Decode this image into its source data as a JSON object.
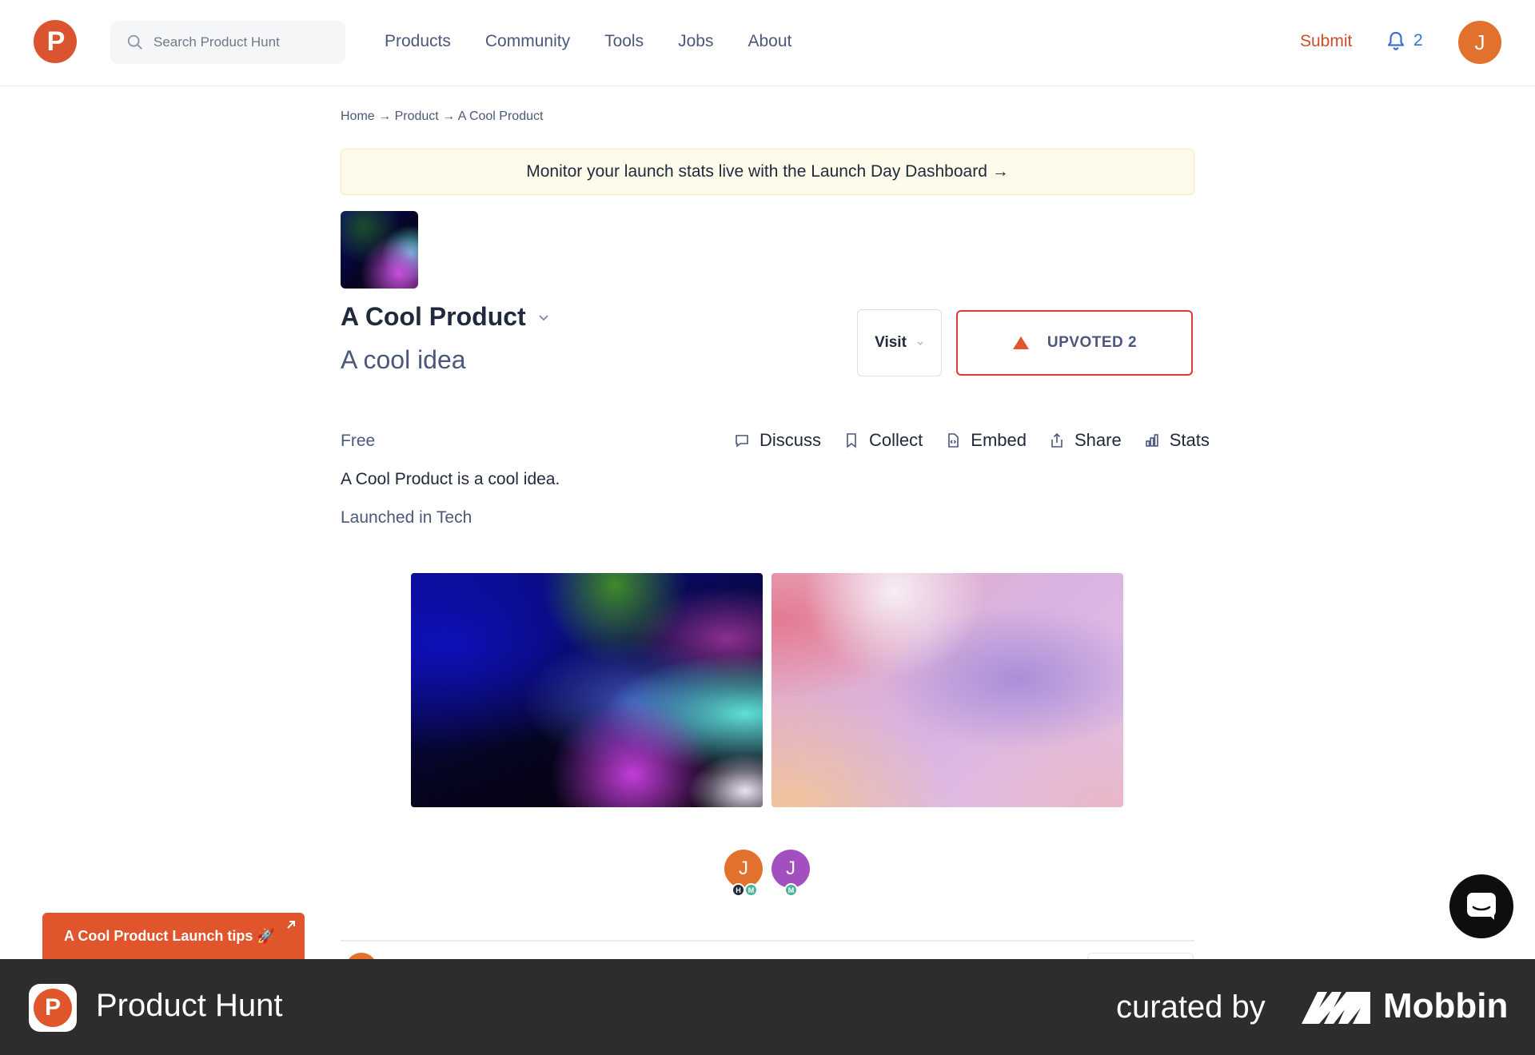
{
  "header": {
    "logo_letter": "P",
    "search_placeholder": "Search Product Hunt",
    "nav": [
      "Products",
      "Community",
      "Tools",
      "Jobs",
      "About"
    ],
    "submit_label": "Submit",
    "notification_count": "2",
    "user_initial": "J"
  },
  "breadcrumb": "Home → Product → A Cool Product",
  "banner": "Monitor your launch stats live with the Launch Day Dashboard →",
  "product": {
    "name": "A Cool Product",
    "tagline": "A cool idea",
    "visit_label": "Visit",
    "upvote_label": "UPVOTED 2",
    "pricing": "Free",
    "description": "A Cool Product is a cool idea.",
    "launched": "Launched in Tech",
    "actions": [
      "Discuss",
      "Collect",
      "Embed",
      "Share",
      "Stats"
    ]
  },
  "makers": [
    {
      "initial": "J",
      "badges": [
        "H",
        "M"
      ]
    },
    {
      "initial": "J",
      "badges": [
        "M"
      ]
    }
  ],
  "launch_tips": "A Cool Product Launch tips 🚀",
  "footer": {
    "logo_letter": "P",
    "app_name": "Product Hunt",
    "curated_by": "curated by",
    "brand": "Mobbin"
  },
  "colors": {
    "brand": "#da552f",
    "upvote_border": "#da3b3b",
    "link_blue": "#3b6ed1"
  }
}
